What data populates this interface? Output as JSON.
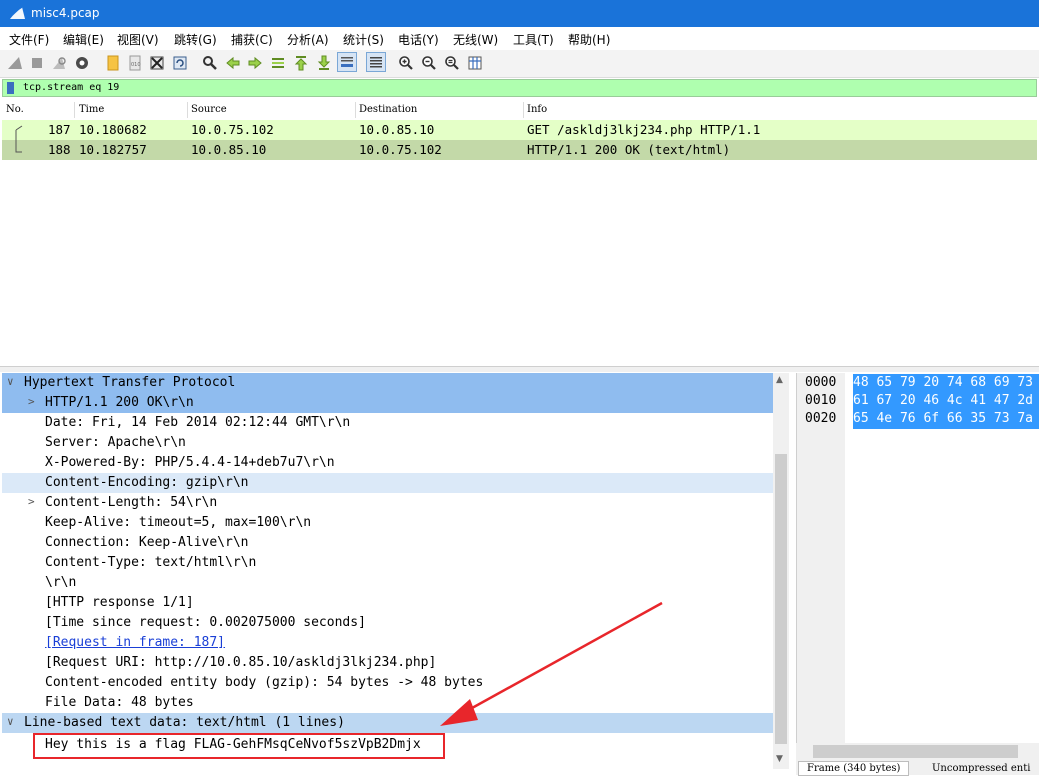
{
  "window": {
    "title": "misc4.pcap"
  },
  "menu": [
    "文件(F)",
    "编辑(E)",
    "视图(V)",
    "跳转(G)",
    "捕获(C)",
    "分析(A)",
    "统计(S)",
    "电话(Y)",
    "无线(W)",
    "工具(T)",
    "帮助(H)"
  ],
  "toolbar": {
    "icons": [
      "shark-fin-start-icon",
      "stop-icon",
      "restart-icon",
      "options-gear-icon",
      "open-folder-icon",
      "save-file-icon",
      "close-file-icon",
      "reload-icon",
      "find-icon",
      "go-back-icon",
      "go-forward-icon",
      "go-to-packet-icon",
      "first-packet-icon",
      "last-packet-icon",
      "autoscroll-icon",
      "colorize-icon",
      "zoom-in-icon",
      "zoom-out-icon",
      "zoom-normal-icon",
      "resize-columns-icon"
    ]
  },
  "filter": {
    "value": "tcp.stream eq 19"
  },
  "packet_list": {
    "columns": [
      "No.",
      "Time",
      "Source",
      "Destination",
      "Info"
    ],
    "rows": [
      {
        "no": "187",
        "time": "10.180682",
        "source": "10.0.75.102",
        "destination": "10.0.85.10",
        "info": "GET /askldj3lkj234.php HTTP/1.1"
      },
      {
        "no": "188",
        "time": "10.182757",
        "source": "10.0.85.10",
        "destination": "10.0.75.102",
        "info": "HTTP/1.1 200 OK  (text/html)"
      }
    ]
  },
  "details": {
    "lines": [
      "Hypertext Transfer Protocol",
      "HTTP/1.1 200 OK\\r\\n",
      "Date: Fri, 14 Feb 2014 02:12:44 GMT\\r\\n",
      "Server: Apache\\r\\n",
      "X-Powered-By: PHP/5.4.4-14+deb7u7\\r\\n",
      "Content-Encoding: gzip\\r\\n",
      "Content-Length: 54\\r\\n",
      "Keep-Alive: timeout=5, max=100\\r\\n",
      "Connection: Keep-Alive\\r\\n",
      "Content-Type: text/html\\r\\n",
      "\\r\\n",
      "[HTTP response 1/1]",
      "[Time since request: 0.002075000 seconds]",
      "[Request in frame: 187]",
      "[Request URI: http://10.0.85.10/askldj3lkj234.php]",
      "Content-encoded entity body (gzip): 54 bytes -> 48 bytes",
      "File Data: 48 bytes",
      "Line-based text data: text/html (1 lines)",
      "Hey this is a flag FLAG-GehFMsqCeNvof5szVpB2Dmjx"
    ]
  },
  "bytes": {
    "rows": [
      {
        "offset": "0000",
        "hex": "48 65 79 20 74 68 69 73"
      },
      {
        "offset": "0010",
        "hex": "61 67 20 46 4c 41 47 2d"
      },
      {
        "offset": "0020",
        "hex": "65 4e 76 6f 66 35 73 7a"
      }
    ],
    "tabs": [
      "Frame (340 bytes)",
      "Uncompressed enti"
    ]
  },
  "colors": {
    "titlebar": "#1a73d9",
    "filter_bg": "#afffaf",
    "row_request": "#e4ffc7",
    "row_response": "#c3d9a8",
    "selection": "#8fbcef",
    "hex_highlight": "#3399ff",
    "annotation_red": "#e8262b"
  }
}
